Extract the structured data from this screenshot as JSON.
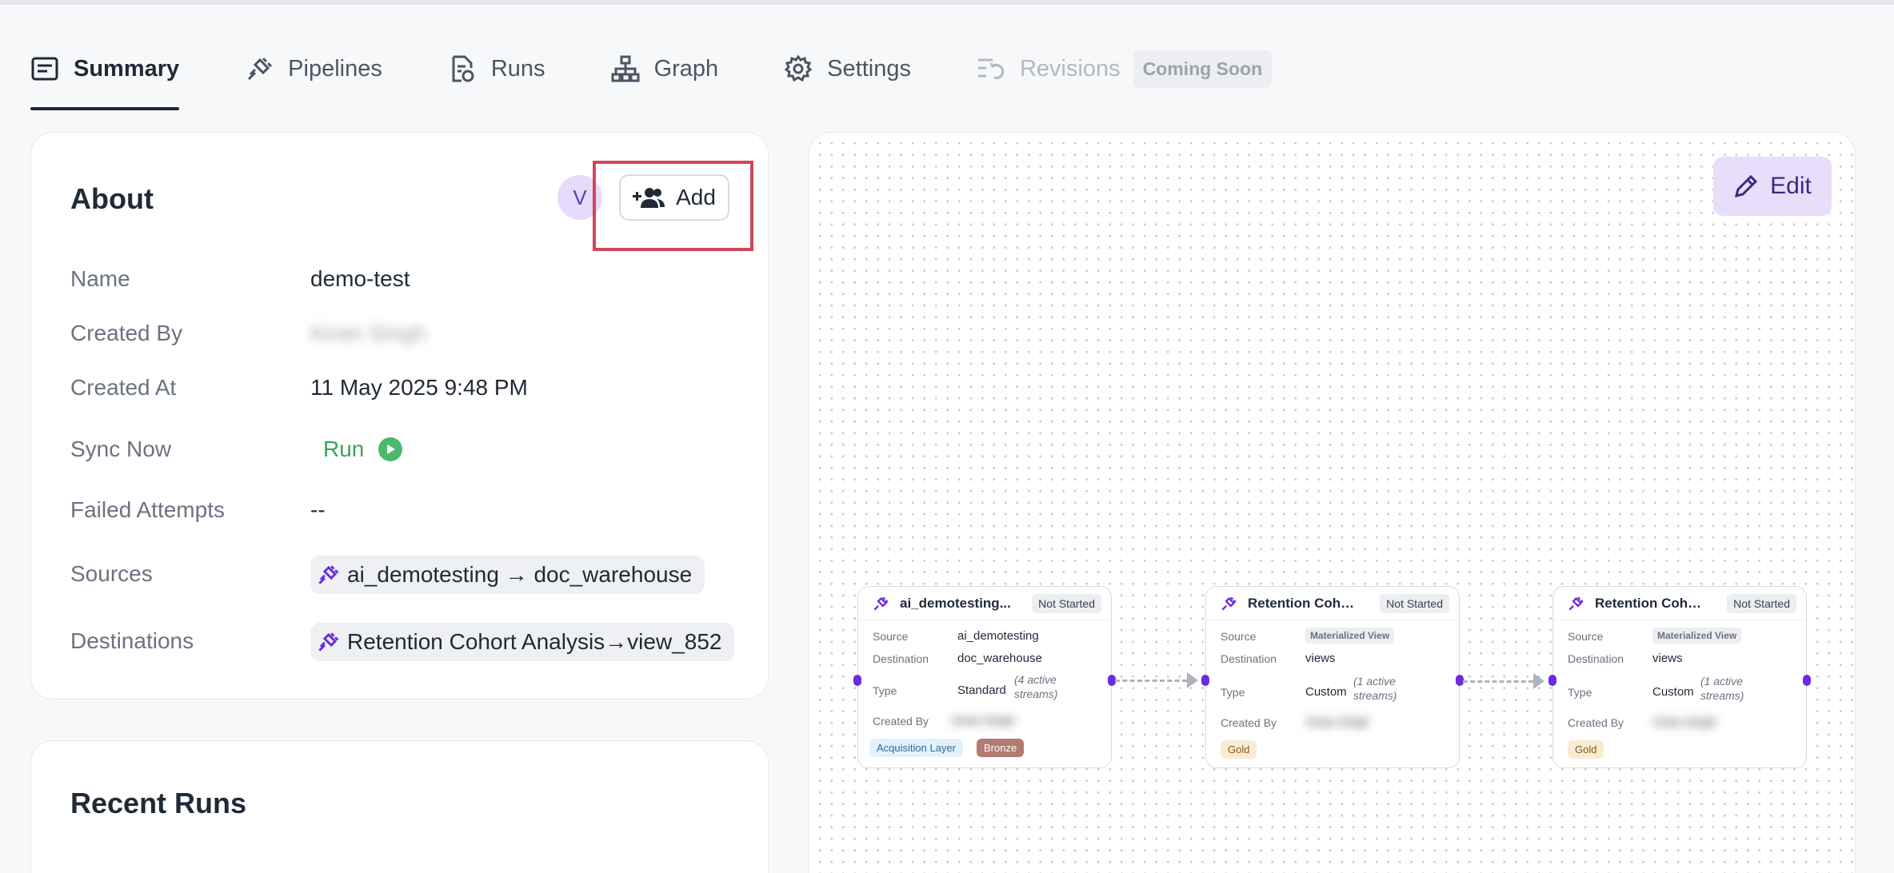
{
  "tabs": [
    {
      "label": "Summary",
      "icon": "summary-icon",
      "state": "active"
    },
    {
      "label": "Pipelines",
      "icon": "plug-icon",
      "state": "normal"
    },
    {
      "label": "Runs",
      "icon": "runs-file-icon",
      "state": "normal"
    },
    {
      "label": "Graph",
      "icon": "graph-hierarchy-icon",
      "state": "normal"
    },
    {
      "label": "Settings",
      "icon": "gear-icon",
      "state": "normal"
    },
    {
      "label": "Revisions",
      "icon": "revisions-icon",
      "state": "disabled",
      "badge": "Coming Soon"
    }
  ],
  "about": {
    "title": "About",
    "avatar_initial": "V",
    "add_label": "Add",
    "rows": {
      "name_label": "Name",
      "name_value": "demo-test",
      "created_by_label": "Created By",
      "created_by_value": "Kiran Singh",
      "created_at_label": "Created At",
      "created_at_value": "11 May 2025 9:48 PM",
      "sync_label": "Sync Now",
      "sync_action": "Run",
      "failed_label": "Failed Attempts",
      "failed_value": "--",
      "sources_label": "Sources",
      "sources_value": "ai_demotesting → doc_warehouse",
      "destinations_label": "Destinations",
      "destinations_value": "Retention Cohort Analysis→view_852"
    }
  },
  "recent_runs": {
    "title": "Recent Runs"
  },
  "graph": {
    "edit_label": "Edit",
    "nodes": [
      {
        "title": "ai_demotesting...",
        "status": "Not Started",
        "source_label": "Source",
        "source": "ai_demotesting",
        "dest_label": "Destination",
        "destination": "doc_warehouse",
        "type_label": "Type",
        "type": "Standard",
        "streams": "(4 active streams)",
        "created_by_label": "Created By",
        "created_by": "Kiran Singh",
        "tags": [
          "Acquisition Layer",
          "Bronze"
        ]
      },
      {
        "title": "Retention Coho...",
        "status": "Not Started",
        "source_label": "Source",
        "source": "Materialized View",
        "dest_label": "Destination",
        "destination": "views",
        "type_label": "Type",
        "type": "Custom",
        "streams": "(1 active streams)",
        "created_by_label": "Created By",
        "created_by": "Kiran Singh",
        "tags": [
          "Gold"
        ]
      },
      {
        "title": "Retention Coho...",
        "status": "Not Started",
        "source_label": "Source",
        "source": "Materialized View",
        "dest_label": "Destination",
        "destination": "views",
        "type_label": "Type",
        "type": "Custom",
        "streams": "(1 active streams)",
        "created_by_label": "Created By",
        "created_by": "Kiran Singh",
        "tags": [
          "Gold"
        ]
      }
    ]
  },
  "colors": {
    "accent_purple": "#6d2ae0",
    "run_green": "#3da35a",
    "highlight_red": "#d2455a",
    "edit_bg": "#e8defa"
  }
}
